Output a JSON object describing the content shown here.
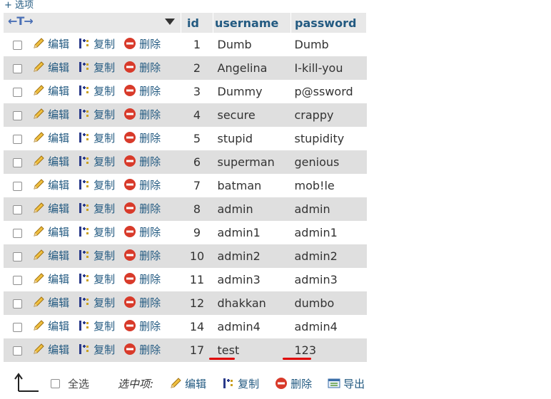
{
  "options_link": "+ 选项",
  "header": {
    "arrows": "←T→",
    "col_id": "id",
    "col_username": "username",
    "col_password": "password"
  },
  "row_actions": {
    "edit": "编辑",
    "copy": "复制",
    "delete": "删除"
  },
  "rows": [
    {
      "id": "1",
      "username": "Dumb",
      "password": "Dumb"
    },
    {
      "id": "2",
      "username": "Angelina",
      "password": "I-kill-you"
    },
    {
      "id": "3",
      "username": "Dummy",
      "password": "p@ssword"
    },
    {
      "id": "4",
      "username": "secure",
      "password": "crappy"
    },
    {
      "id": "5",
      "username": "stupid",
      "password": "stupidity"
    },
    {
      "id": "6",
      "username": "superman",
      "password": "genious"
    },
    {
      "id": "7",
      "username": "batman",
      "password": "mob!le"
    },
    {
      "id": "8",
      "username": "admin",
      "password": "admin"
    },
    {
      "id": "9",
      "username": "admin1",
      "password": "admin1"
    },
    {
      "id": "10",
      "username": "admin2",
      "password": "admin2"
    },
    {
      "id": "11",
      "username": "admin3",
      "password": "admin3"
    },
    {
      "id": "12",
      "username": "dhakkan",
      "password": "dumbo"
    },
    {
      "id": "14",
      "username": "admin4",
      "password": "admin4"
    },
    {
      "id": "17",
      "username": "test",
      "password": "123"
    }
  ],
  "bottom": {
    "select_all": "全选",
    "with_selected": "选中项:",
    "edit": "编辑",
    "copy": "复制",
    "delete": "删除",
    "export": "导出"
  },
  "colors": {
    "link": "#235a81",
    "row_alt": "#dfdfdf",
    "header_bg": "#e8e8e8",
    "annotation_underline": "#e00000"
  }
}
